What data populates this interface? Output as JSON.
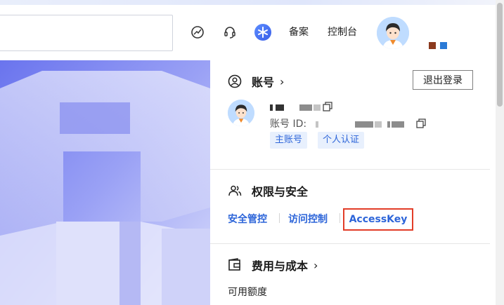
{
  "header": {
    "search": {
      "placeholder": ""
    },
    "icons": [
      "globe-icon",
      "support-headset-icon",
      "ai-assistant-icon"
    ],
    "links": {
      "beian": "备案",
      "console": "控制台"
    },
    "user_name": ""
  },
  "account_panel": {
    "account": {
      "title": "账号",
      "chevron": "›",
      "logout_label": "退出登录",
      "id_label": "账号 ID:",
      "tags": [
        "主账号",
        "个人认证"
      ]
    },
    "permissions": {
      "title": "权限与安全",
      "links": [
        "安全管控",
        "访问控制",
        "AccessKey"
      ],
      "highlighted": "AccessKey",
      "highlight_color": "#e23d28"
    },
    "billing": {
      "title": "费用与成本",
      "chevron": "›",
      "available_quota_label": "可用额度"
    }
  },
  "colors": {
    "link_blue": "#2d65d9",
    "tag_bg": "#e8f0fd",
    "hero_purple": "#8d95f2"
  }
}
